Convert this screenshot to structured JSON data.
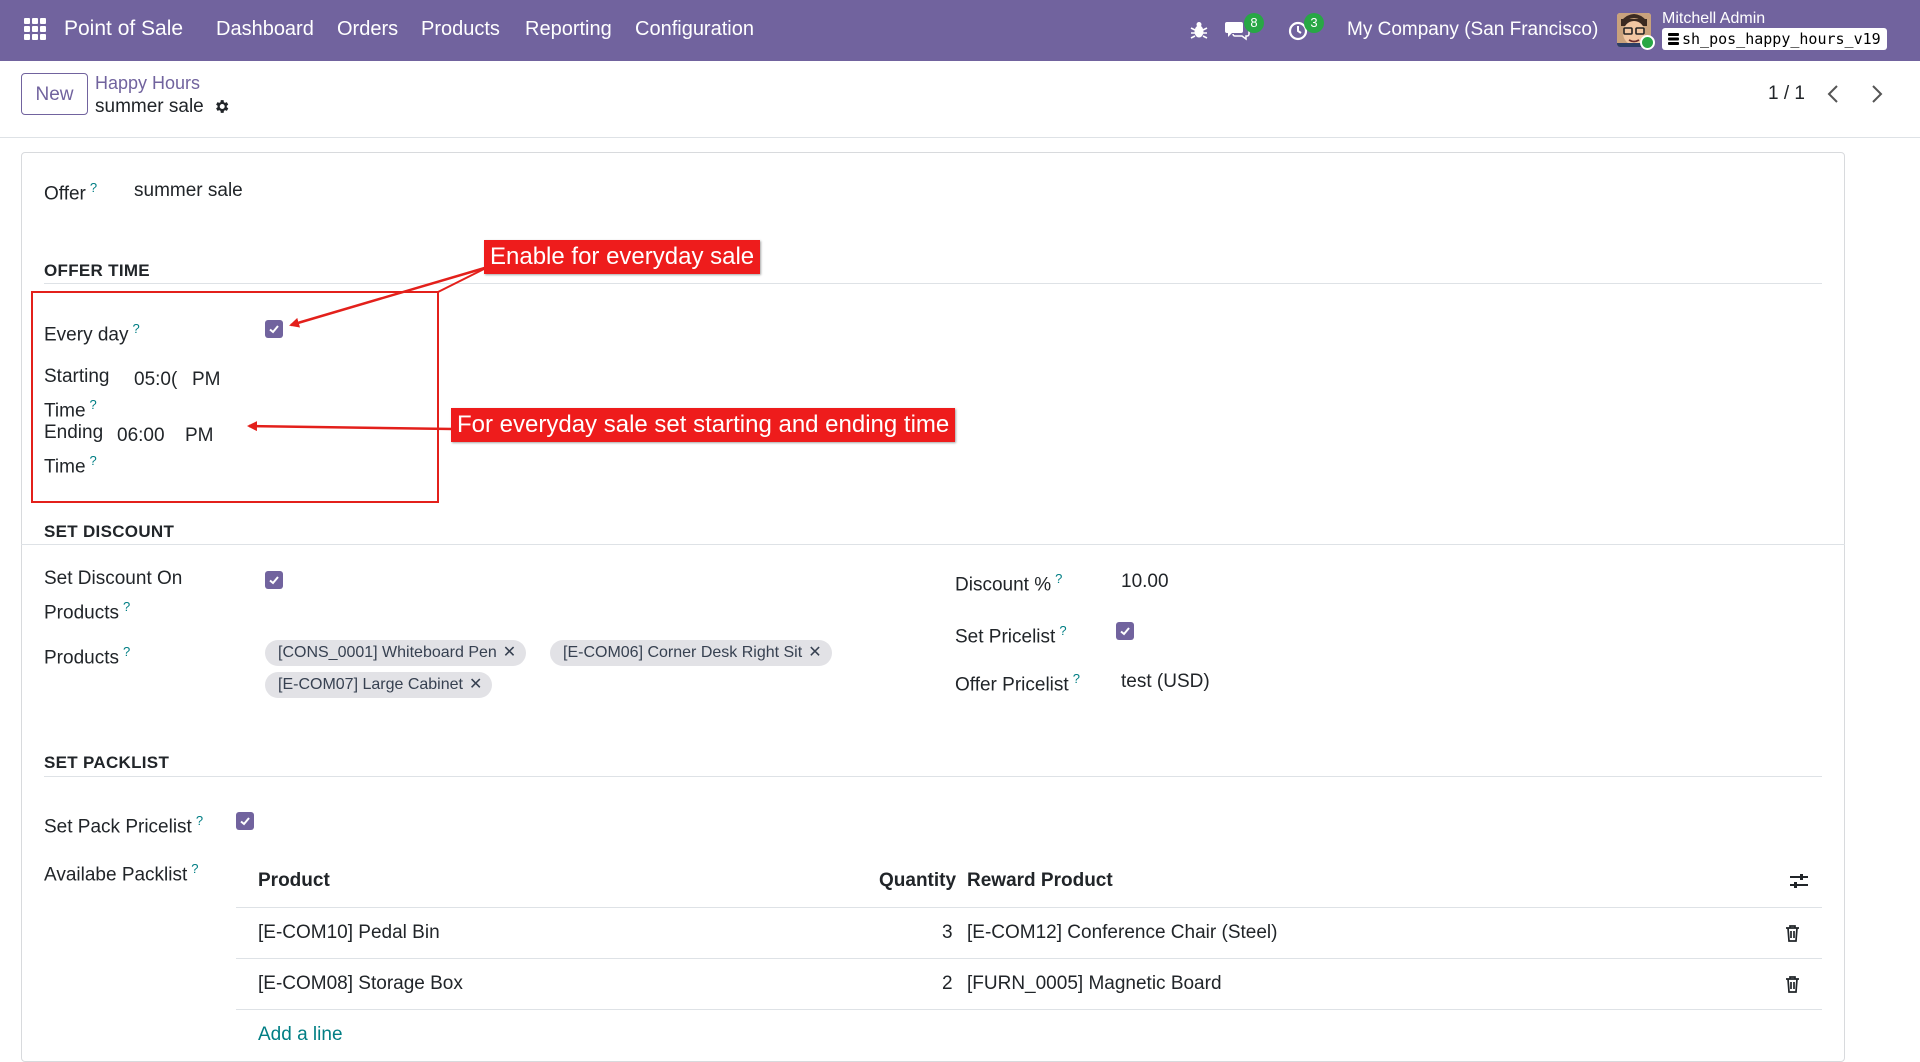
{
  "navbar": {
    "app_name": "Point of Sale",
    "menu": [
      "Dashboard",
      "Orders",
      "Products",
      "Reporting",
      "Configuration"
    ],
    "messages_count": "8",
    "activities_count": "3",
    "company": "My Company (San Francisco)",
    "user_name": "Mitchell Admin",
    "database": "sh_pos_happy_hours_v19"
  },
  "control_panel": {
    "new_label": "New",
    "breadcrumb_parent": "Happy Hours",
    "record_name": "summer sale",
    "pager": "1 / 1"
  },
  "form": {
    "offer": {
      "label": "Offer",
      "value": "summer sale"
    },
    "offer_time": {
      "section_title": "OFFER TIME",
      "every_day_label": "Every day",
      "every_day_checked": true,
      "starting_time_label_1": "Starting",
      "starting_time_label_2": "Time",
      "starting_time_value": "05:0(",
      "starting_time_ampm": "PM",
      "ending_time_label_1": "Ending",
      "ending_time_label_2": "Time",
      "ending_time_value": "06:00",
      "ending_time_ampm": "PM"
    },
    "set_discount": {
      "section_title": "SET DISCOUNT",
      "set_discount_on_products_label_1": "Set Discount On",
      "set_discount_on_products_label_2": "Products",
      "set_discount_on_products_checked": true,
      "products_label": "Products",
      "products": [
        "[CONS_0001] Whiteboard Pen",
        "[E-COM06] Corner Desk Right Sit",
        "[E-COM07] Large Cabinet"
      ],
      "discount_label": "Discount %",
      "discount_value": "10.00",
      "set_pricelist_label": "Set Pricelist",
      "set_pricelist_checked": true,
      "offer_pricelist_label": "Offer Pricelist",
      "offer_pricelist_value": "test (USD)"
    },
    "set_packlist": {
      "section_title": "SET PACKLIST",
      "set_pack_pricelist_label": "Set Pack Pricelist",
      "set_pack_pricelist_checked": true,
      "available_packlist_label": "Availabe Packlist",
      "columns": {
        "product": "Product",
        "quantity": "Quantity",
        "reward": "Reward Product"
      },
      "rows": [
        {
          "product": "[E-COM10] Pedal Bin",
          "quantity": "3",
          "reward": "[E-COM12] Conference Chair (Steel)"
        },
        {
          "product": "[E-COM08] Storage Box",
          "quantity": "2",
          "reward": "[FURN_0005] Magnetic Board"
        }
      ],
      "add_line": "Add a line"
    }
  },
  "annotations": {
    "everyday": "Enable for everyday sale",
    "time": "For everyday sale set starting and ending time"
  },
  "colors": {
    "brand": "#71639e",
    "annotation": "#ee1c1c",
    "badge": "#28a745"
  }
}
